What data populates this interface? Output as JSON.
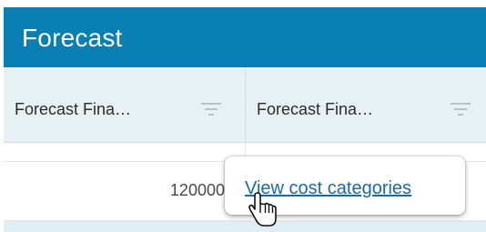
{
  "header": {
    "title": "Forecast"
  },
  "columns": [
    {
      "label": "Forecast Fina…"
    },
    {
      "label": "Forecast Fina…"
    }
  ],
  "rows": [
    {
      "value": ""
    },
    {
      "value": "120000"
    }
  ],
  "popup": {
    "link_label": "View cost categories"
  },
  "icons": {
    "filter": "filter-icon",
    "cursor": "hand-pointer-icon"
  },
  "colors": {
    "header_bg": "#0a7fb3",
    "column_header_bg": "#e7f1f5",
    "link": "#1a6aa8"
  }
}
